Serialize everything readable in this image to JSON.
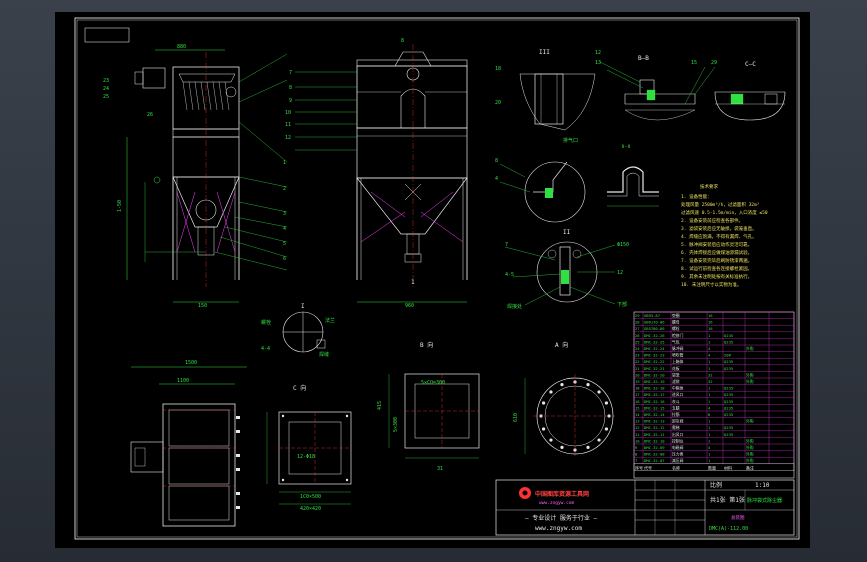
{
  "colors": {
    "background": "#000000",
    "frame": "#ffffff",
    "outline": "#e8e8e8",
    "dimension": "#30e040",
    "centerline": "#ff3030",
    "hidden": "#ff40ff",
    "notes": "#f0e060",
    "logo": "#ff3030"
  },
  "section_labels": {
    "section_i": "I",
    "section_ii": "II",
    "section_iii": "III",
    "section_b": "B—B",
    "section_c": "C—C",
    "view_c": "C 向",
    "view_b": "B 向",
    "view_a": "A 向",
    "view_1": "1",
    "detail": "排气口",
    "notes_title": "技术要求"
  },
  "dimensions": {
    "front_top_width": "880",
    "front_height": "1-50",
    "front_base_width": "150",
    "side_top_width": "8",
    "side_base_width": "960",
    "plan_width": "1100",
    "plan_overall": "1500",
    "c_view_inner": "1C0×500",
    "c_view_outer": "420×420",
    "b_view_side": "415",
    "b_view_height": "5×300",
    "b_view_width": "5×CO=300",
    "b_view_base": "31",
    "a_view_diameter": "610"
  },
  "notes": [
    "1. 设备性能：",
    "   处理风量 2500m³/h，过滤面积 32m²",
    "   过滤风速 0.5-1.5m/min，入口浓度 ≤50",
    "2. 设备安装前应检查各部件。",
    "3. 滤袋安装后应无破损，袋笼垂直。",
    "4. 焊缝应饱满，不得有漏焊、气孔。",
    "5. 脉冲阀安装后应动作灵活可靠。",
    "6. 壳体焊接后应做煤油渗漏试验。",
    "7. 设备安装完毕后刷防锈漆两遍。",
    "8. 试运行前检查各连接螺栓紧固。",
    "9. 其余未注明处按有关标准执行。",
    "10. 未注明尺寸以实物为准。"
  ],
  "callouts_left": [
    "23",
    "24",
    "25",
    "26"
  ],
  "callouts_right": [
    "1",
    "2",
    "3",
    "4",
    "5",
    "6",
    "7",
    "8",
    "9",
    "10",
    "11",
    "12"
  ],
  "bom": {
    "rows": [
      [
        "29",
        "GB93-87",
        "垫圈",
        "16",
        "",
        ""
      ],
      [
        "28",
        "GB6170-86",
        "螺母",
        "16",
        "",
        ""
      ],
      [
        "27",
        "GB5780-86",
        "螺栓",
        "16",
        "",
        ""
      ],
      [
        "26",
        "DMC-32-26",
        "检修门",
        "1",
        "Q235",
        ""
      ],
      [
        "25",
        "DMC-32-25",
        "气包",
        "1",
        "Q235",
        ""
      ],
      [
        "24",
        "DMC-32-24",
        "脉冲阀",
        "4",
        "",
        "外购"
      ],
      [
        "23",
        "DMC-32-23",
        "喷吹管",
        "4",
        "20#",
        ""
      ],
      [
        "22",
        "DMC-32-22",
        "上箱体",
        "1",
        "Q235",
        ""
      ],
      [
        "21",
        "DMC-32-21",
        "花板",
        "1",
        "Q235",
        ""
      ],
      [
        "20",
        "DMC-32-20",
        "袋笼",
        "32",
        "",
        "外购"
      ],
      [
        "19",
        "DMC-32-19",
        "滤袋",
        "32",
        "",
        "外购"
      ],
      [
        "18",
        "DMC-32-18",
        "中箱体",
        "1",
        "Q235",
        ""
      ],
      [
        "17",
        "DMC-32-17",
        "进风口",
        "1",
        "Q235",
        ""
      ],
      [
        "16",
        "DMC-32-16",
        "灰斗",
        "1",
        "Q235",
        ""
      ],
      [
        "15",
        "DMC-32-15",
        "支腿",
        "4",
        "Q235",
        ""
      ],
      [
        "14",
        "DMC-32-14",
        "拉筋",
        "8",
        "Q235",
        ""
      ],
      [
        "13",
        "DMC-32-13",
        "卸灰阀",
        "1",
        "",
        "外购"
      ],
      [
        "12",
        "DMC-32-12",
        "爬梯",
        "1",
        "Q235",
        ""
      ],
      [
        "11",
        "DMC-32-11",
        "出风口",
        "1",
        "Q235",
        ""
      ],
      [
        "10",
        "DMC-32-10",
        "控制仪",
        "1",
        "",
        "外购"
      ],
      [
        "9",
        "DMC-32-09",
        "电磁阀",
        "4",
        "",
        "外购"
      ],
      [
        "8",
        "DMC-32-08",
        "压力表",
        "1",
        "",
        "外购"
      ],
      [
        "7",
        "DMC-32-07",
        "减压阀",
        "1",
        "",
        "外购"
      ]
    ],
    "header": [
      "序号",
      "代号",
      "名称",
      "数量",
      "材料",
      "备注"
    ]
  },
  "title_block": {
    "logo_text": "中国图库资源工具网",
    "logo_url": "www.zngyw.com",
    "slogan": "— 专业设计  服务于行业 —",
    "site": "www.zngyw.com",
    "drawing_name": "总装图",
    "drawing_code": "DMC(A)-112.00",
    "scale_label": "比例",
    "scale_value": "1:10",
    "company": "脉冲袋式除尘器",
    "sheet_label": "共1张 第1张"
  }
}
